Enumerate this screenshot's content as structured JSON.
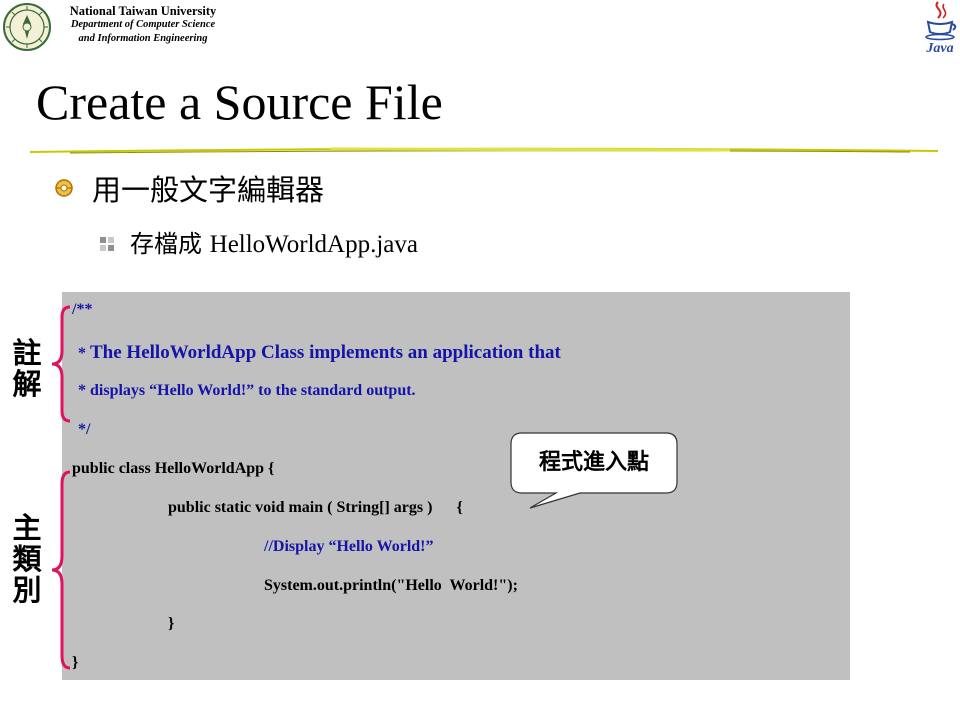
{
  "header": {
    "university": "National Taiwan University",
    "department_line1": "Department of Computer Science",
    "department_line2": "and Information Engineering",
    "java_logo_text": "Java"
  },
  "title": "Create a Source File",
  "bullets": {
    "level1": "用一般文字編輯器",
    "level2_prefix": "存檔成 ",
    "level2_filename": "HelloWorldApp.java"
  },
  "code": {
    "line1": "/**",
    "line2_star": "* ",
    "line2_text": "The HelloWorldApp Class implements an application that",
    "line3": "* displays “Hello World!” to the standard output.",
    "line4": "*/",
    "line5": "public class HelloWorldApp {",
    "line6": "public static void main ( String[] args )      {",
    "line7": "//Display “Hello World!”",
    "line8": "System.out.println(\"Hello  World!\");",
    "line9": "}",
    "line10": "}"
  },
  "labels": {
    "comment_char1": "註",
    "comment_char2": "解",
    "main_char1": "主",
    "main_char2": "類",
    "main_char3": "別"
  },
  "callout": {
    "text": "程式進入點"
  },
  "colors": {
    "comment_text": "#1414a8",
    "code_background": "#c0c0c0",
    "brace": "#e0115f",
    "bullet1": "#c08000",
    "bullet2": "#b0b0b0",
    "rule": "#c8c800"
  }
}
